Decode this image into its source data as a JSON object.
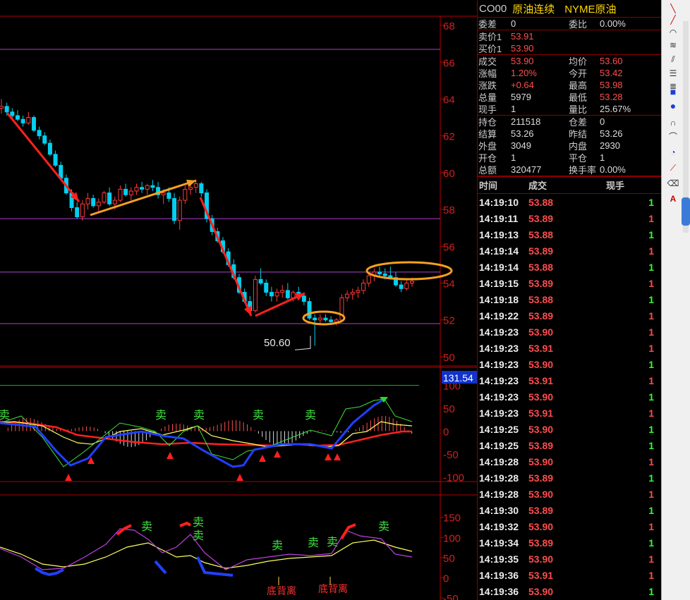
{
  "header": {
    "code": "CO00",
    "name": "原油连续",
    "exchange": "NYME原油"
  },
  "quote": {
    "rows1": [
      {
        "l1": "委差",
        "v1": "0",
        "c1": "white",
        "l2": "委比",
        "v2": "0.00%",
        "c2": "white"
      }
    ],
    "rows2": [
      {
        "l1": "卖价1",
        "v1": "53.91",
        "c1": "red"
      },
      {
        "l1": "买价1",
        "v1": "53.90",
        "c1": "red"
      }
    ],
    "rows3": [
      {
        "l1": "成交",
        "v1": "53.90",
        "c1": "red",
        "l2": "均价",
        "v2": "53.60",
        "c2": "red"
      },
      {
        "l1": "涨幅",
        "v1": "1.20%",
        "c1": "red",
        "l2": "今开",
        "v2": "53.42",
        "c2": "red"
      },
      {
        "l1": "涨跌",
        "v1": "+0.64",
        "c1": "red",
        "l2": "最高",
        "v2": "53.98",
        "c2": "red"
      },
      {
        "l1": "总量",
        "v1": "5979",
        "c1": "white",
        "l2": "最低",
        "v2": "53.28",
        "c2": "red"
      },
      {
        "l1": "现手",
        "v1": "1",
        "c1": "white",
        "l2": "量比",
        "v2": "25.67%",
        "c2": "white"
      }
    ],
    "rows4": [
      {
        "l1": "持仓",
        "v1": "211518",
        "c1": "white",
        "l2": "仓差",
        "v2": "0",
        "c2": "white"
      },
      {
        "l1": "结算",
        "v1": "53.26",
        "c1": "white",
        "l2": "昨结",
        "v2": "53.26",
        "c2": "white"
      },
      {
        "l1": "外盘",
        "v1": "3049",
        "c1": "white",
        "l2": "内盘",
        "v2": "2930",
        "c2": "white"
      },
      {
        "l1": "开仓",
        "v1": "1",
        "c1": "white",
        "l2": "平仓",
        "v2": "1",
        "c2": "white"
      },
      {
        "l1": "总额",
        "v1": "320477",
        "c1": "white",
        "l2": "换手率",
        "v2": "0.00%",
        "c2": "white"
      }
    ]
  },
  "ticks": {
    "headers": [
      "时间",
      "成交",
      "现手"
    ],
    "rows": [
      {
        "time": "14:19:10",
        "price": "53.88",
        "vol": "1",
        "vc": "green"
      },
      {
        "time": "14:19:11",
        "price": "53.89",
        "vol": "1",
        "vc": "red"
      },
      {
        "time": "14:19:13",
        "price": "53.88",
        "vol": "1",
        "vc": "green"
      },
      {
        "time": "14:19:14",
        "price": "53.89",
        "vol": "1",
        "vc": "red"
      },
      {
        "time": "14:19:14",
        "price": "53.88",
        "vol": "1",
        "vc": "green"
      },
      {
        "time": "14:19:15",
        "price": "53.89",
        "vol": "1",
        "vc": "red"
      },
      {
        "time": "14:19:18",
        "price": "53.88",
        "vol": "1",
        "vc": "green"
      },
      {
        "time": "14:19:22",
        "price": "53.89",
        "vol": "1",
        "vc": "red"
      },
      {
        "time": "14:19:23",
        "price": "53.90",
        "vol": "1",
        "vc": "red"
      },
      {
        "time": "14:19:23",
        "price": "53.91",
        "vol": "1",
        "vc": "red"
      },
      {
        "time": "14:19:23",
        "price": "53.90",
        "vol": "1",
        "vc": "green"
      },
      {
        "time": "14:19:23",
        "price": "53.91",
        "vol": "1",
        "vc": "red"
      },
      {
        "time": "14:19:23",
        "price": "53.90",
        "vol": "1",
        "vc": "green"
      },
      {
        "time": "14:19:23",
        "price": "53.91",
        "vol": "1",
        "vc": "red"
      },
      {
        "time": "14:19:25",
        "price": "53.90",
        "vol": "1",
        "vc": "green"
      },
      {
        "time": "14:19:25",
        "price": "53.89",
        "vol": "1",
        "vc": "green"
      },
      {
        "time": "14:19:28",
        "price": "53.90",
        "vol": "1",
        "vc": "red"
      },
      {
        "time": "14:19:28",
        "price": "53.89",
        "vol": "1",
        "vc": "green"
      },
      {
        "time": "14:19:28",
        "price": "53.90",
        "vol": "1",
        "vc": "red"
      },
      {
        "time": "14:19:30",
        "price": "53.89",
        "vol": "1",
        "vc": "green"
      },
      {
        "time": "14:19:32",
        "price": "53.90",
        "vol": "1",
        "vc": "red"
      },
      {
        "time": "14:19:34",
        "price": "53.89",
        "vol": "1",
        "vc": "green"
      },
      {
        "time": "14:19:35",
        "price": "53.90",
        "vol": "1",
        "vc": "red"
      },
      {
        "time": "14:19:36",
        "price": "53.91",
        "vol": "1",
        "vc": "red"
      },
      {
        "time": "14:19:36",
        "price": "53.90",
        "vol": "1",
        "vc": "green"
      }
    ]
  },
  "chart_data": [
    {
      "type": "candlestick",
      "y_ticks": [
        "68",
        "66",
        "64",
        "62",
        "60",
        "58",
        "56",
        "54",
        "52",
        "50"
      ],
      "ylim": [
        49.5,
        68.5
      ],
      "h_lines": [
        66.7,
        57.5,
        54.6,
        51.8
      ],
      "candles": [
        [
          63.5,
          64.0,
          63.2,
          63.6
        ],
        [
          63.6,
          63.8,
          63.1,
          63.3
        ],
        [
          63.3,
          63.5,
          62.9,
          63.1
        ],
        [
          63.1,
          63.4,
          62.8,
          62.9
        ],
        [
          62.9,
          63.1,
          62.5,
          62.7
        ],
        [
          62.7,
          63.3,
          62.6,
          63.0
        ],
        [
          63.0,
          63.1,
          62.2,
          62.3
        ],
        [
          62.3,
          62.5,
          61.8,
          62.0
        ],
        [
          62.0,
          62.2,
          61.5,
          61.6
        ],
        [
          61.6,
          61.8,
          60.9,
          61.0
        ],
        [
          61.0,
          61.2,
          60.3,
          60.4
        ],
        [
          60.4,
          60.6,
          59.6,
          59.7
        ],
        [
          59.7,
          59.9,
          58.8,
          58.9
        ],
        [
          58.9,
          59.1,
          57.9,
          58.1
        ],
        [
          58.1,
          58.4,
          57.5,
          57.6
        ],
        [
          57.6,
          58.5,
          57.4,
          58.3
        ],
        [
          58.3,
          58.9,
          58.0,
          58.6
        ],
        [
          58.6,
          58.8,
          58.1,
          58.2
        ],
        [
          58.2,
          58.6,
          57.9,
          58.4
        ],
        [
          58.4,
          59.0,
          58.3,
          58.9
        ],
        [
          58.9,
          59.2,
          58.2,
          58.3
        ],
        [
          58.3,
          58.7,
          58.0,
          58.5
        ],
        [
          58.5,
          59.3,
          58.4,
          59.1
        ],
        [
          59.1,
          59.4,
          58.7,
          58.8
        ],
        [
          58.8,
          59.2,
          58.5,
          59.0
        ],
        [
          59.0,
          59.4,
          58.8,
          59.2
        ],
        [
          59.2,
          59.5,
          58.9,
          59.1
        ],
        [
          59.1,
          59.4,
          58.8,
          59.3
        ],
        [
          59.3,
          59.6,
          59.0,
          59.2
        ],
        [
          59.2,
          59.5,
          58.6,
          58.8
        ],
        [
          58.8,
          59.1,
          58.3,
          58.9
        ],
        [
          58.9,
          59.2,
          58.4,
          58.6
        ],
        [
          58.6,
          58.9,
          57.2,
          57.4
        ],
        [
          57.4,
          58.7,
          56.9,
          58.5
        ],
        [
          58.5,
          59.3,
          58.3,
          59.1
        ],
        [
          59.1,
          59.5,
          58.8,
          59.2
        ],
        [
          59.2,
          59.6,
          58.9,
          59.4
        ],
        [
          59.4,
          59.5,
          58.7,
          58.9
        ],
        [
          58.9,
          59.1,
          57.3,
          57.5
        ],
        [
          57.5,
          57.7,
          56.6,
          56.8
        ],
        [
          56.8,
          57.0,
          56.2,
          56.3
        ],
        [
          56.3,
          56.5,
          55.6,
          55.7
        ],
        [
          55.7,
          55.9,
          54.9,
          55.0
        ],
        [
          55.0,
          55.3,
          54.2,
          54.3
        ],
        [
          54.3,
          54.5,
          53.4,
          53.5
        ],
        [
          53.5,
          53.7,
          52.9,
          53.0
        ],
        [
          53.0,
          53.3,
          52.3,
          52.5
        ],
        [
          52.5,
          54.4,
          52.4,
          54.2
        ],
        [
          54.2,
          54.8,
          53.9,
          54.0
        ],
        [
          54.0,
          54.2,
          53.3,
          53.5
        ],
        [
          53.5,
          53.8,
          53.0,
          53.3
        ],
        [
          53.3,
          53.7,
          53.0,
          53.5
        ],
        [
          53.5,
          53.9,
          53.2,
          53.6
        ],
        [
          53.6,
          54.0,
          53.1,
          53.2
        ],
        [
          53.2,
          53.6,
          53.0,
          53.5
        ],
        [
          53.5,
          53.8,
          53.1,
          53.3
        ],
        [
          53.3,
          53.5,
          52.8,
          53.0
        ],
        [
          53.0,
          53.2,
          52.0,
          52.1
        ],
        [
          52.1,
          52.3,
          50.6,
          52.0
        ],
        [
          52.0,
          52.3,
          51.8,
          52.1
        ],
        [
          52.1,
          52.3,
          51.9,
          52.0
        ],
        [
          52.0,
          52.2,
          51.8,
          51.9
        ],
        [
          51.9,
          52.1,
          51.7,
          52.0
        ],
        [
          52.0,
          53.4,
          51.9,
          53.2
        ],
        [
          53.2,
          53.6,
          53.0,
          53.4
        ],
        [
          53.4,
          53.7,
          53.1,
          53.5
        ],
        [
          53.5,
          53.8,
          53.2,
          53.6
        ],
        [
          53.6,
          54.2,
          53.4,
          54.0
        ],
        [
          54.0,
          54.6,
          53.8,
          54.4
        ],
        [
          54.4,
          54.8,
          54.1,
          54.6
        ],
        [
          54.6,
          54.9,
          54.3,
          54.5
        ],
        [
          54.5,
          54.8,
          54.2,
          54.4
        ],
        [
          54.4,
          54.9,
          54.2,
          54.3
        ],
        [
          54.3,
          54.6,
          53.8,
          53.9
        ],
        [
          53.9,
          54.1,
          53.5,
          53.7
        ],
        [
          53.7,
          54.2,
          53.6,
          54.0
        ],
        [
          54.0,
          54.3,
          53.8,
          54.1
        ]
      ],
      "annotation_label": "50.60",
      "annotation_value": 50.6
    },
    {
      "type": "line",
      "y_ticks": [
        "100",
        "50",
        "0",
        "-50",
        "-100"
      ],
      "ylim": [
        -110,
        110
      ],
      "badge": "131.54",
      "signal_labels": [
        "卖",
        "卖",
        "卖",
        "卖",
        "卖"
      ]
    },
    {
      "type": "line",
      "y_ticks": [
        "150",
        "100",
        "50",
        "0",
        "-50"
      ],
      "ylim": [
        -55,
        195
      ],
      "signal_labels": [
        "卖",
        "卖",
        "卖",
        "卖",
        "卖",
        "卖"
      ],
      "divergence_labels": [
        "底背离",
        "底背离"
      ]
    }
  ]
}
